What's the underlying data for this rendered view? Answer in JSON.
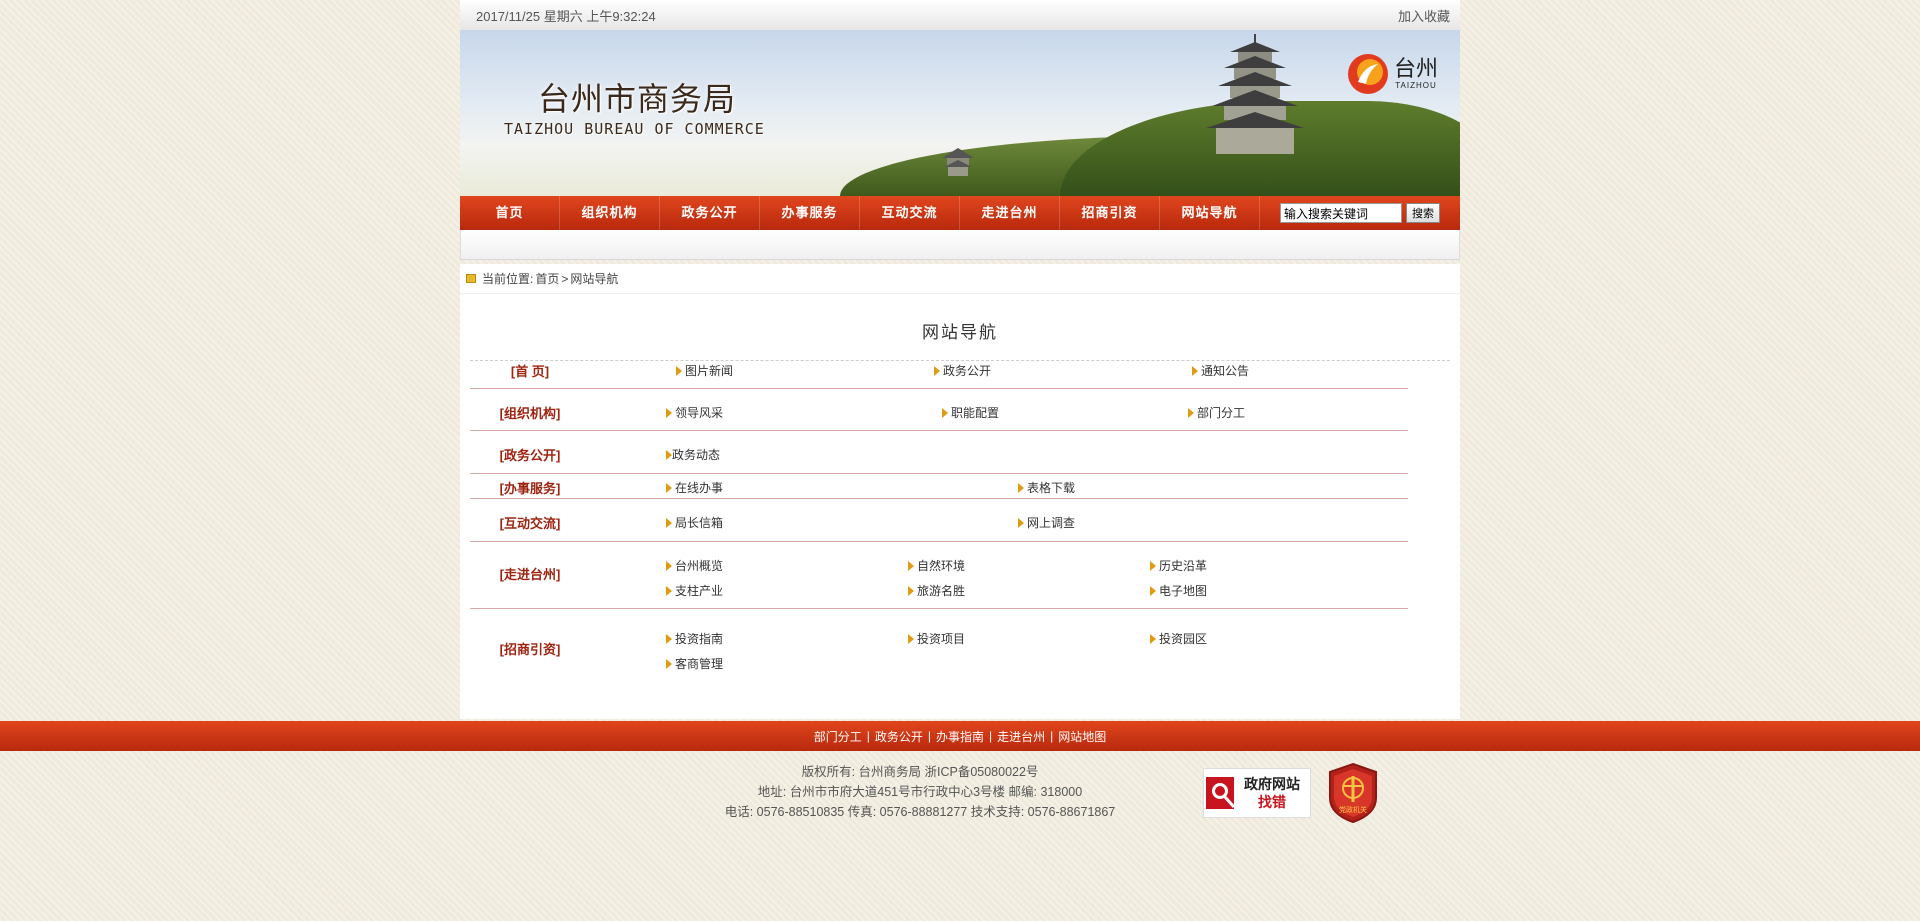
{
  "topbar": {
    "datetime": "2017/11/25 星期六 上午9:32:24",
    "bookmark_label": "加入收藏"
  },
  "banner": {
    "title_cn": "台州市商务局",
    "title_en": "TAIZHOU BUREAU OF COMMERCE",
    "logo_cn": "台州",
    "logo_en": "TAIZHOU"
  },
  "nav": {
    "items": [
      "首页",
      "组织机构",
      "政务公开",
      "办事服务",
      "互动交流",
      "走进台州",
      "招商引资",
      "网站导航"
    ]
  },
  "search": {
    "value": "输入搜索关键词",
    "button_label": "搜索"
  },
  "breadcrumb": {
    "prefix": "当前位置:",
    "home": "首页",
    "sep": ">",
    "current": "网站导航"
  },
  "page_title": "网站导航",
  "sitemap": [
    {
      "category": "[首 页]",
      "links": [
        "图片新闻",
        "政务公开",
        "通知公告"
      ]
    },
    {
      "category": "[组织机构]",
      "links": [
        "领导风采",
        "职能配置",
        "部门分工"
      ]
    },
    {
      "category": "[政务公开]",
      "links": [
        "政务动态"
      ]
    },
    {
      "category": "[办事服务]",
      "links": [
        "在线办事",
        "表格下载"
      ]
    },
    {
      "category": "[互动交流]",
      "links": [
        "局长信箱",
        "网上调查"
      ]
    },
    {
      "category": "[走进台州]",
      "links": [
        "台州概览",
        "自然环境",
        "历史沿革",
        "支柱产业",
        "旅游名胜",
        "电子地图"
      ]
    },
    {
      "category": "[招商引资]",
      "links": [
        "投资指南",
        "投资项目",
        "投资园区",
        "客商管理"
      ]
    }
  ],
  "footer": {
    "links": [
      "部门分工",
      "政务公开",
      "办事指南",
      "走进台州",
      "网站地图"
    ],
    "separator": "|",
    "copyright": "版权所有: 台州商务局 浙ICP备05080022号",
    "address": "地址: 台州市市府大道451号市行政中心3号楼 邮编: 318000",
    "contact": "电话: 0576-88510835 传真: 0576-88881277 技术支持: 0576-88671867",
    "badge1_top": "政府网站",
    "badge1_bottom": "找错",
    "badge2_text": "党政机关"
  },
  "colors": {
    "nav_red": "#c9320f",
    "category_red": "#9e2412",
    "arrow_orange": "#e09b12",
    "page_bg": "#efeadb"
  }
}
